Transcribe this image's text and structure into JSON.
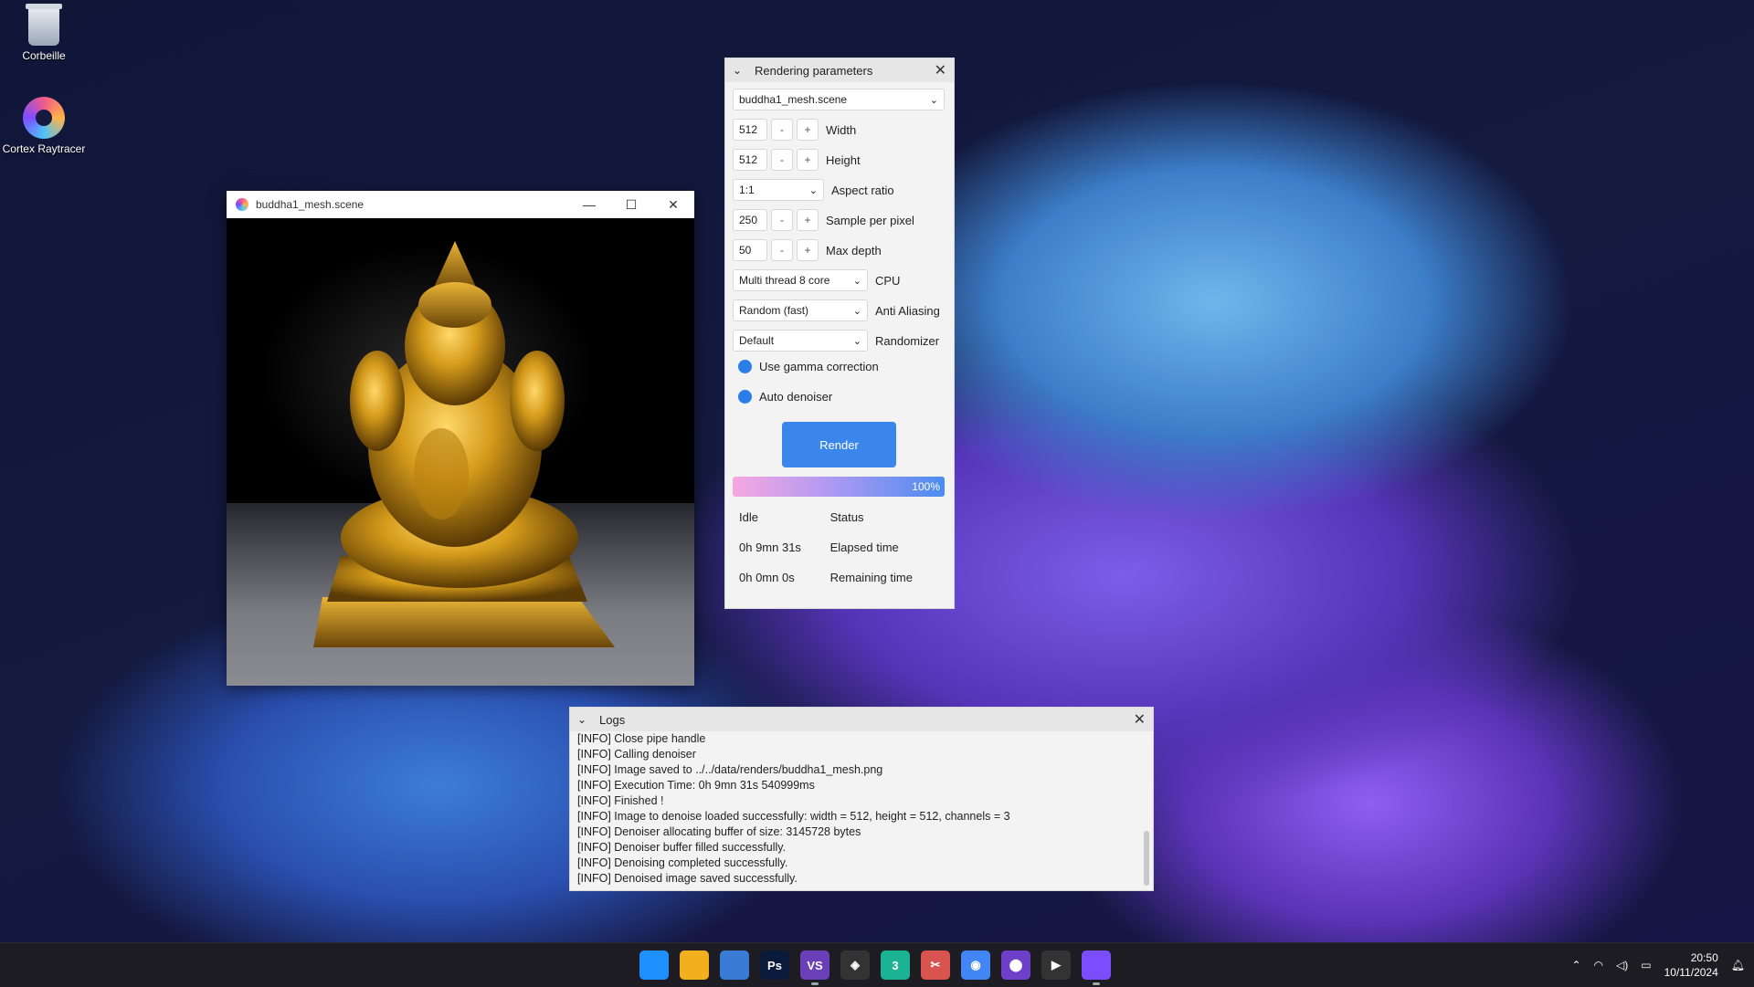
{
  "desktop": {
    "icons": [
      {
        "label": "Corbeille",
        "icon": "recycle-bin-icon"
      },
      {
        "label": "Cortex Raytracer",
        "icon": "cortex-raytracer-icon"
      }
    ]
  },
  "viewer": {
    "title": "buddha1_mesh.scene",
    "controls": {
      "minimize": "—",
      "maximize": "☐",
      "close": "✕"
    }
  },
  "params": {
    "title": "Rendering parameters",
    "scene": "buddha1_mesh.scene",
    "width": {
      "value": "512",
      "label": "Width"
    },
    "height": {
      "value": "512",
      "label": "Height"
    },
    "aspect": {
      "value": "1:1",
      "label": "Aspect ratio"
    },
    "spp": {
      "value": "250",
      "label": "Sample per pixel"
    },
    "depth": {
      "value": "50",
      "label": "Max depth"
    },
    "cpu": {
      "value": "Multi thread 8 core",
      "label": "CPU"
    },
    "aa": {
      "value": "Random (fast)",
      "label": "Anti Aliasing"
    },
    "randomizer": {
      "value": "Default",
      "label": "Randomizer"
    },
    "gamma": {
      "label": "Use gamma correction",
      "checked": true
    },
    "denoiser": {
      "label": "Auto denoiser",
      "checked": true
    },
    "render_label": "Render",
    "progress": {
      "percent": 100,
      "text": "100%"
    },
    "status": {
      "value": "Idle",
      "label": "Status"
    },
    "elapsed": {
      "value": "0h 9mn 31s",
      "label": "Elapsed time"
    },
    "remaining": {
      "value": "0h 0mn 0s",
      "label": "Remaining time"
    },
    "minus": "-",
    "plus": "+"
  },
  "logs": {
    "title": "Logs",
    "lines": [
      "[INFO] Close pipe handle",
      "[INFO] Calling denoiser",
      "[INFO] Image saved to ../../data/renders/buddha1_mesh.png",
      "[INFO] Execution Time: 0h 9mn 31s 540999ms",
      "[INFO] Finished !",
      "[INFO] Image to denoise loaded successfully: width = 512, height = 512, channels = 3",
      "[INFO] Denoiser allocating buffer of size: 3145728 bytes",
      "[INFO] Denoiser buffer filled successfully.",
      "[INFO] Denoising completed successfully.",
      "[INFO] Denoised image saved successfully."
    ]
  },
  "taskbar": {
    "apps": [
      {
        "name": "start",
        "glyph": "",
        "color": "#1e90ff"
      },
      {
        "name": "file-explorer",
        "glyph": "",
        "color": "#f2b01e"
      },
      {
        "name": "store",
        "glyph": "",
        "color": "#3a7bd5"
      },
      {
        "name": "photoshop",
        "glyph": "Ps",
        "color": "#0a1a3a"
      },
      {
        "name": "visual-studio",
        "glyph": "VS",
        "color": "#6a3fb8"
      },
      {
        "name": "unity",
        "glyph": "◈",
        "color": "#333"
      },
      {
        "name": "app-3",
        "glyph": "3",
        "color": "#1ab394"
      },
      {
        "name": "snipping-tool",
        "glyph": "✂",
        "color": "#d9534f"
      },
      {
        "name": "chrome",
        "glyph": "◉",
        "color": "#4285f4"
      },
      {
        "name": "github",
        "glyph": "⬤",
        "color": "#6e40c9"
      },
      {
        "name": "media-player",
        "glyph": "▶",
        "color": "#333"
      },
      {
        "name": "cortex-raytracer",
        "glyph": "",
        "color": "#7c4dff"
      }
    ],
    "time": "20:50",
    "date": "10/11/2024"
  }
}
